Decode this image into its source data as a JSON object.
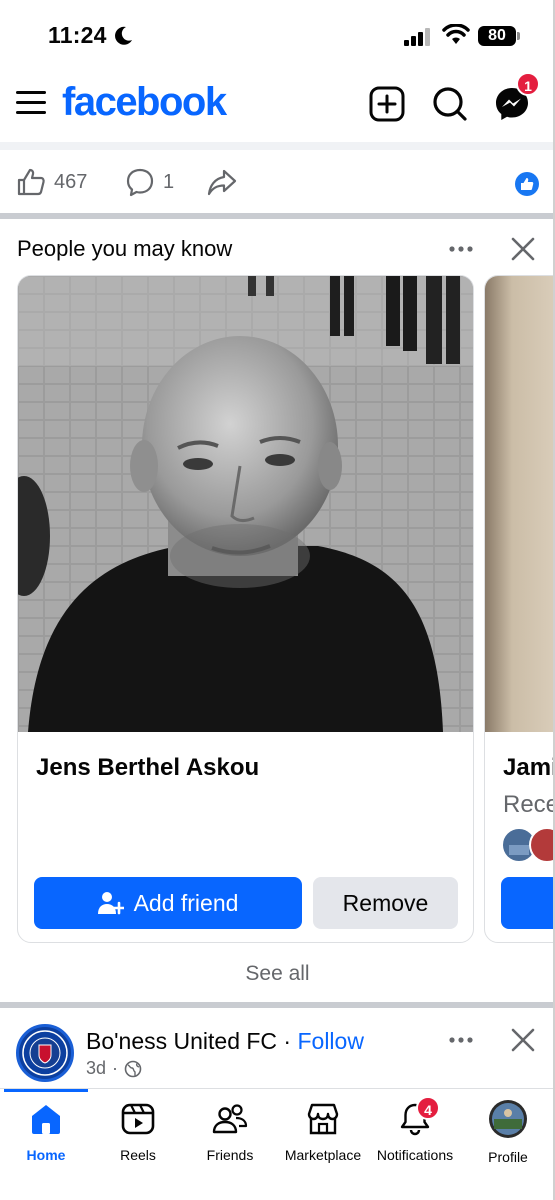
{
  "status_bar": {
    "time": "11:24",
    "battery": "80"
  },
  "header": {
    "logo": "facebook",
    "messenger_badge": "1",
    "icons": [
      "menu-icon",
      "create-icon",
      "search-icon",
      "messenger-icon"
    ]
  },
  "post_actions": {
    "like_count": "467",
    "comment_count": "1"
  },
  "pymk": {
    "title": "People you may know",
    "cards": [
      {
        "name": "Jens Berthel Askou",
        "add_label": "Add friend",
        "remove_label": "Remove"
      },
      {
        "name": "Jami",
        "subtitle": "Rece"
      }
    ],
    "see_all": "See all"
  },
  "next_post": {
    "page_name": "Bo'ness United FC",
    "separator": "·",
    "follow": "Follow",
    "age": "3d",
    "meta_separator": "·"
  },
  "bottom_nav": {
    "items": [
      {
        "label": "Home",
        "icon": "home-icon",
        "active": true
      },
      {
        "label": "Reels",
        "icon": "reels-icon"
      },
      {
        "label": "Friends",
        "icon": "friends-icon"
      },
      {
        "label": "Marketplace",
        "icon": "marketplace-icon"
      },
      {
        "label": "Notifications",
        "icon": "bell-icon"
      },
      {
        "label": "Profile",
        "icon": "profile-avatar"
      }
    ],
    "notifications_badge": "4"
  },
  "colors": {
    "brand": "#0866ff",
    "badge": "#e41e3f",
    "secondary_text": "#65676b"
  }
}
